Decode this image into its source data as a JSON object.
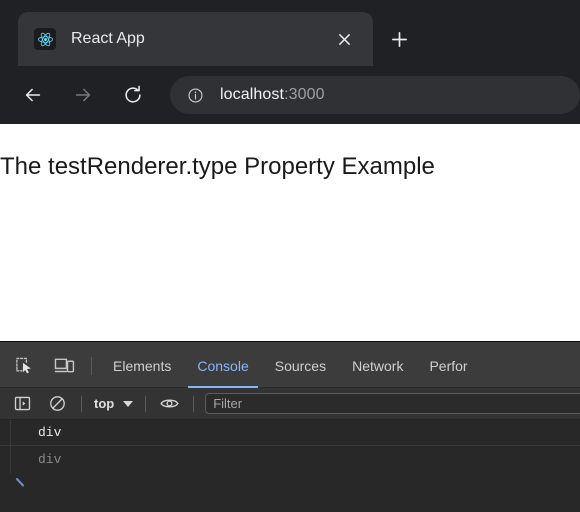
{
  "browser": {
    "tab": {
      "title": "React App",
      "favicon_icon": "react-logo-icon",
      "close_icon": "close-icon"
    },
    "new_tab": {
      "icon": "plus-icon",
      "label": "+"
    },
    "nav": {
      "back_icon": "back-arrow-icon",
      "forward_icon": "forward-arrow-icon",
      "reload_icon": "reload-icon"
    },
    "omnibox": {
      "info_icon": "info-circle-icon",
      "host": "localhost",
      "rest": ":3000",
      "full_url": "localhost:3000"
    }
  },
  "page": {
    "heading": "The testRenderer.type Property Example",
    "background": "#ffffff"
  },
  "devtools": {
    "toolbar": {
      "inspect_icon": "inspect-element-icon",
      "device_icon": "device-toolbar-icon"
    },
    "tabs": [
      {
        "label": "Elements",
        "active": false
      },
      {
        "label": "Console",
        "active": true
      },
      {
        "label": "Sources",
        "active": false
      },
      {
        "label": "Network",
        "active": false
      },
      {
        "label": "Perfor",
        "active": false
      }
    ],
    "filterbar": {
      "sidebar_icon": "console-sidebar-icon",
      "clear_icon": "clear-console-icon",
      "context": "top",
      "context_caret_icon": "chevron-down-icon",
      "eye_icon": "live-expression-eye-icon",
      "filter_placeholder": "Filter",
      "filter_value": ""
    },
    "console_messages": [
      {
        "text": "div",
        "kind": "output"
      },
      {
        "text": "div",
        "kind": "echo"
      }
    ],
    "prompt": {
      "icon": "prompt-chevron-icon",
      "value": ""
    }
  },
  "colors": {
    "chrome_bg": "#202124",
    "tab_active": "#35363a",
    "omnibox_bg": "#2f3134",
    "devtools_toolbar": "#3c3c3c",
    "devtools_console": "#282828",
    "accent_blue": "#8ab4f8",
    "react_cyan": "#61dafb"
  }
}
